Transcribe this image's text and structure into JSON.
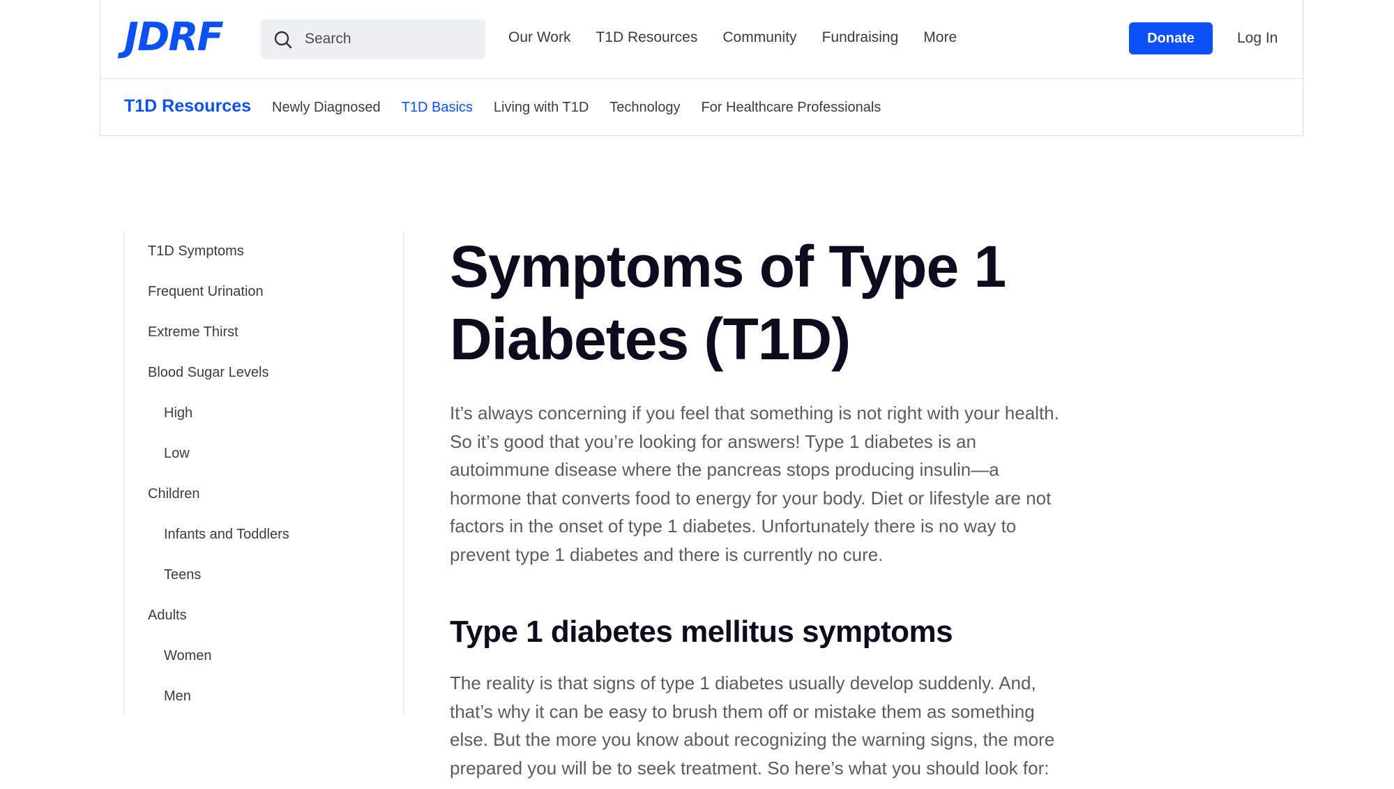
{
  "header": {
    "logo": "JDRF",
    "search_placeholder": "Search",
    "nav": [
      "Our Work",
      "T1D Resources",
      "Community",
      "Fundraising",
      "More"
    ],
    "donate_label": "Donate",
    "login_label": "Log In",
    "brand_color": "#0b51f5"
  },
  "subnav": {
    "title": "T1D Resources",
    "items": [
      "Newly Diagnosed",
      "T1D Basics",
      "Living with T1D",
      "Technology",
      "For Healthcare Professionals"
    ],
    "active": "T1D Basics"
  },
  "sidebar": {
    "items": [
      {
        "label": "T1D Symptoms",
        "level": 1
      },
      {
        "label": "Frequent Urination",
        "level": 1
      },
      {
        "label": "Extreme Thirst",
        "level": 1
      },
      {
        "label": "Blood Sugar Levels",
        "level": 1
      },
      {
        "label": "High",
        "level": 2
      },
      {
        "label": "Low",
        "level": 2
      },
      {
        "label": "Children",
        "level": 1
      },
      {
        "label": "Infants and Toddlers",
        "level": 2
      },
      {
        "label": "Teens",
        "level": 2
      },
      {
        "label": "Adults",
        "level": 1
      },
      {
        "label": "Women",
        "level": 2
      },
      {
        "label": "Men",
        "level": 2
      }
    ]
  },
  "article": {
    "title_line1": "Symptoms of Type 1",
    "title_line2": "Diabetes (T1D)",
    "intro_lines": [
      "It’s always concerning if you feel that something is not right with your health.",
      "So it’s good that you’re looking for answers! Type 1 diabetes is an",
      "autoimmune disease where the pancreas stops producing insulin—a",
      "hormone that converts food to energy for your body. Diet or lifestyle are not",
      "factors in the onset of type 1 diabetes. Unfortunately there is no way to",
      "prevent type 1 diabetes and there is currently no cure."
    ],
    "section_heading": "Type 1 diabetes mellitus symptoms",
    "section_lines": [
      "The reality is that signs of type 1 diabetes usually develop suddenly. And,",
      "that’s why it can be easy to brush them off or mistake them as something",
      "else. But the more you know about recognizing the warning signs, the more",
      "prepared you will be to seek treatment. So here’s what you should look for:"
    ]
  }
}
